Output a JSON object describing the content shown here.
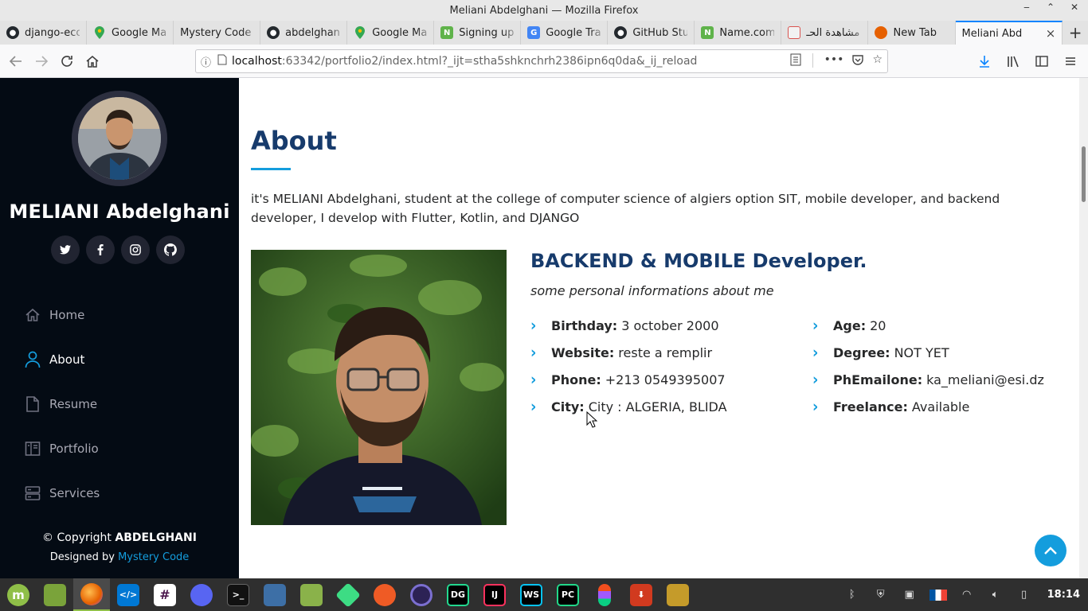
{
  "window": {
    "title": "Meliani Abdelghani — Mozilla Firefox"
  },
  "tabs": [
    {
      "label": "django-eco",
      "icon": "github-icon",
      "color": "#24292e"
    },
    {
      "label": "Google Ma",
      "icon": "google-maps-icon",
      "color": "#34a853"
    },
    {
      "label": "Mystery Code",
      "icon": "",
      "color": ""
    },
    {
      "label": "abdelghani",
      "icon": "github-icon",
      "color": "#24292e"
    },
    {
      "label": "Google Ma",
      "icon": "google-maps-icon",
      "color": "#34a853"
    },
    {
      "label": "Signing up",
      "icon": "n-icon",
      "color": "#5fb34a"
    },
    {
      "label": "Google Tra",
      "icon": "google-translate-icon",
      "color": "#4285f4"
    },
    {
      "label": "GitHub Stu",
      "icon": "github-icon",
      "color": "#24292e"
    },
    {
      "label": "Name.com",
      "icon": "n-icon",
      "color": "#5fb34a"
    },
    {
      "label": "مشاهدة الحـ",
      "icon": "site-icon",
      "color": "#d9534f"
    },
    {
      "label": "New Tab",
      "icon": "firefox-icon",
      "color": "#e66000"
    }
  ],
  "active_tab": {
    "label": "Meliani Abd",
    "close": "×"
  },
  "url": {
    "host": "localhost",
    "rest": ":63342/portfolio2/index.html?_ijt=stha5shknchrh2386ipn6q0da&_ij_reload"
  },
  "sidebar": {
    "name": "MELIANI Abdelghani",
    "socials": [
      "twitter-icon",
      "facebook-icon",
      "instagram-icon",
      "github-icon"
    ],
    "nav": [
      {
        "label": "Home",
        "icon": "home-icon",
        "active": false
      },
      {
        "label": "About",
        "icon": "user-icon",
        "active": true
      },
      {
        "label": "Resume",
        "icon": "file-icon",
        "active": false
      },
      {
        "label": "Portfolio",
        "icon": "book-icon",
        "active": false
      },
      {
        "label": "Services",
        "icon": "server-icon",
        "active": false
      }
    ],
    "copyright_prefix": "© Copyright",
    "copyright_name": "ABDELGHANI",
    "designed_by": "Designed by",
    "designer": "Mystery Code"
  },
  "about": {
    "title": "About",
    "description": "it's MELIANI Abdelghani, student at the college of computer science of algiers option SIT, mobile developer, and backend developer, I develop with Flutter, Kotlin, and DJANGO",
    "role_title": "BACKEND & MOBILE Developer.",
    "subtitle": "some personal informations about me",
    "left_info": [
      {
        "label": "Birthday:",
        "value": "3 october 2000"
      },
      {
        "label": "Website:",
        "value": "reste a remplir"
      },
      {
        "label": "Phone:",
        "value": "+213 0549395007"
      },
      {
        "label": "City:",
        "value": "City : ALGERIA, BLIDA"
      }
    ],
    "right_info": [
      {
        "label": "Age:",
        "value": "20"
      },
      {
        "label": "Degree:",
        "value": "NOT YET"
      },
      {
        "label": "PhEmailone:",
        "value": "ka_meliani@esi.dz"
      },
      {
        "label": "Freelance:",
        "value": "Available"
      }
    ]
  },
  "taskbar": {
    "apps": [
      {
        "name": "mint-menu-icon",
        "color": "#8fbf48",
        "glyph": "m"
      },
      {
        "name": "files-icon",
        "color": "#7aa33a",
        "glyph": ""
      },
      {
        "name": "firefox-icon",
        "color": "#e66000",
        "glyph": "",
        "active": true
      },
      {
        "name": "vscode-icon",
        "color": "#0078d4",
        "glyph": "</>"
      },
      {
        "name": "slack-icon",
        "color": "#4a154b",
        "glyph": "#"
      },
      {
        "name": "discord-icon",
        "color": "#5865f2",
        "glyph": ""
      },
      {
        "name": "terminal-icon",
        "color": "#111111",
        "glyph": ">_"
      },
      {
        "name": "screenshot-icon",
        "color": "#3d6fa6",
        "glyph": ""
      },
      {
        "name": "folder-icon",
        "color": "#8ab24a",
        "glyph": ""
      },
      {
        "name": "android-studio-icon",
        "color": "#3ddc84",
        "glyph": ""
      },
      {
        "name": "postman-icon",
        "color": "#ef5b25",
        "glyph": ""
      },
      {
        "name": "eclipse-icon",
        "color": "#2c2255",
        "glyph": ""
      },
      {
        "name": "datagrip-icon",
        "color": "#22d88f",
        "glyph": "DG"
      },
      {
        "name": "intellij-icon",
        "color": "#000000",
        "glyph": "IJ"
      },
      {
        "name": "webstorm-icon",
        "color": "#07c3f2",
        "glyph": "WS"
      },
      {
        "name": "pycharm-icon",
        "color": "#21d789",
        "glyph": "PC"
      },
      {
        "name": "figma-icon",
        "color": "#f24e1e",
        "glyph": ""
      },
      {
        "name": "downloader-icon",
        "color": "#d13a1f",
        "glyph": ""
      },
      {
        "name": "network-tool-icon",
        "color": "#c59b2a",
        "glyph": ""
      }
    ],
    "tray": [
      "bluetooth-icon",
      "shield-info-icon",
      "clipboard-icon",
      "flag-fr-icon",
      "wifi-icon",
      "volume-icon",
      "battery-icon"
    ],
    "clock": "18:14"
  },
  "colors": {
    "accent": "#149ddd",
    "sidebar_bg": "#040b14",
    "heading": "#173b6c"
  }
}
